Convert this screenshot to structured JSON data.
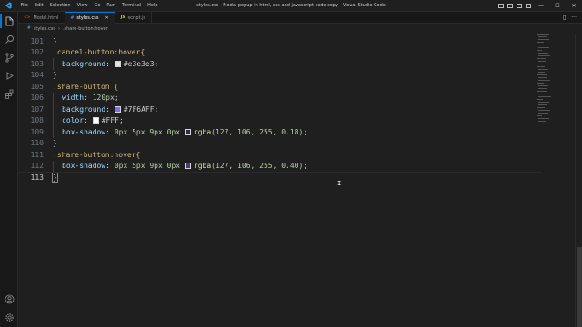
{
  "titlebar": {
    "title": "styles.css - Modal popup in html, css and javascript code copy - Visual Studio Code",
    "menu": [
      "File",
      "Edit",
      "Selection",
      "View",
      "Go",
      "Run",
      "Terminal",
      "Help"
    ],
    "controls": {
      "minimize": "—",
      "maximize": "☐",
      "close": "✕"
    }
  },
  "tabs": [
    {
      "label": "Modal.html",
      "icon": "<>",
      "icon_color": "#e44d26",
      "active": false
    },
    {
      "label": "styles.css",
      "icon": "#",
      "icon_color": "#519aba",
      "active": true,
      "close": "✕"
    },
    {
      "label": "script.js",
      "icon": "JS",
      "icon_color": "#cbcb41",
      "active": false
    }
  ],
  "tab_actions": {
    "split": "▯",
    "more": "···"
  },
  "breadcrumb": {
    "file": "styles.css",
    "sep": "›",
    "symbol": ".share-button:hover",
    "file_icon": "#"
  },
  "editor": {
    "current_line": 113,
    "lines": [
      {
        "num": "101",
        "text": "}"
      },
      {
        "num": "102",
        "text": ".cancel-button:hover{"
      },
      {
        "num": "103",
        "prop": "background:",
        "swatch": "#e3e3e3",
        "value": "#e3e3e3",
        "end": ";"
      },
      {
        "num": "104",
        "text": "}"
      },
      {
        "num": "105",
        "text": ".share-button {"
      },
      {
        "num": "106",
        "prop": "width:",
        "value": "120px",
        "end": ";"
      },
      {
        "num": "107",
        "prop": "background:",
        "swatch": "#7F6AFF",
        "value": "#7F6AFF",
        "end": ";"
      },
      {
        "num": "108",
        "prop": "color:",
        "swatch": "#FFFFFF",
        "value": "#FFF",
        "end": ";"
      },
      {
        "num": "109",
        "prop": "box-shadow:",
        "value": "0px 5px 9px 0px",
        "swatch": "#7F6AFF",
        "fn": "rgba",
        "args": "(127, 106, 255, 0.18)",
        "end": ";"
      },
      {
        "num": "110",
        "text": "}"
      },
      {
        "num": "111",
        "text": ".share-button:hover{"
      },
      {
        "num": "112",
        "prop": "box-shadow:",
        "value": "0px 5px 9px 0px",
        "swatch": "#7F6AFF",
        "fn": "rgba",
        "args": "(127, 106, 255, 0.40)",
        "end": ";"
      },
      {
        "num": "113",
        "text": "}"
      }
    ]
  },
  "colors": {
    "accent": "#0078d4",
    "selector": "#d7ba7d",
    "property": "#9cdcfe",
    "number": "#b5cea8",
    "function": "#dcdcaa"
  },
  "activity_icons": [
    "explorer-icon",
    "search-icon",
    "source-control-icon",
    "run-debug-icon",
    "extensions-icon",
    "account-icon",
    "settings-gear-icon"
  ]
}
